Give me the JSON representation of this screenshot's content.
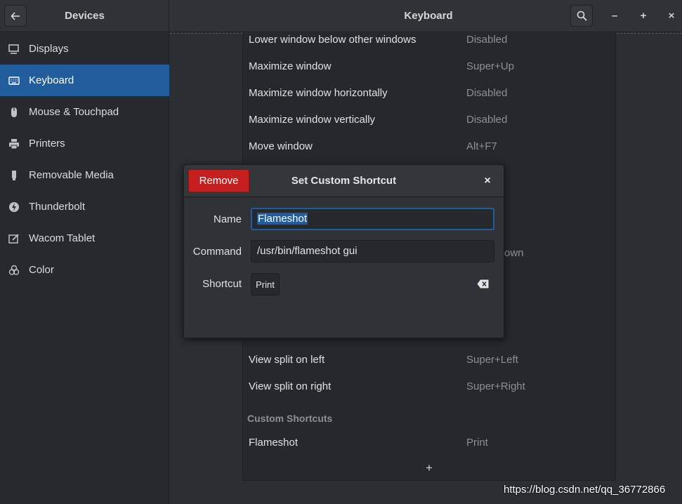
{
  "header": {
    "left_title": "Devices",
    "main_title": "Keyboard",
    "minimize": "–",
    "maximize": "+",
    "close": "×"
  },
  "sidebar": {
    "items": [
      {
        "label": "Displays",
        "icon": "display-icon",
        "active": false
      },
      {
        "label": "Keyboard",
        "icon": "keyboard-icon",
        "active": true
      },
      {
        "label": "Mouse & Touchpad",
        "icon": "mouse-icon",
        "active": false
      },
      {
        "label": "Printers",
        "icon": "printer-icon",
        "active": false
      },
      {
        "label": "Removable Media",
        "icon": "usb-icon",
        "active": false
      },
      {
        "label": "Thunderbolt",
        "icon": "thunderbolt-icon",
        "active": false
      },
      {
        "label": "Wacom Tablet",
        "icon": "tablet-icon",
        "active": false
      },
      {
        "label": "Color",
        "icon": "color-icon",
        "active": false
      }
    ]
  },
  "shortcuts": {
    "rows": [
      {
        "name": "Lower window below other windows",
        "key": "Disabled"
      },
      {
        "name": "Maximize window",
        "key": "Super+Up"
      },
      {
        "name": "Maximize window horizontally",
        "key": "Disabled"
      },
      {
        "name": "Maximize window vertically",
        "key": "Disabled"
      },
      {
        "name": "Move window",
        "key": "Alt+F7"
      },
      {
        "name": "View split on left",
        "key": "Super+Left"
      },
      {
        "name": "View split on right",
        "key": "Super+Right"
      }
    ],
    "partial_key_text": "own",
    "custom_section_title": "Custom Shortcuts",
    "custom_rows": [
      {
        "name": "Flameshot",
        "key": "Print"
      }
    ],
    "add_label": "+"
  },
  "dialog": {
    "title": "Set Custom Shortcut",
    "remove_label": "Remove",
    "close_label": "×",
    "name_label": "Name",
    "name_value": "Flameshot",
    "command_label": "Command",
    "command_value": "/usr/bin/flameshot gui",
    "shortcut_label": "Shortcut",
    "shortcut_value": "Print"
  },
  "watermark": "https://blog.csdn.net/qq_36772866",
  "colors": {
    "accent": "#215d9c",
    "destructive": "#c51f1f",
    "background": "#2b2e33"
  }
}
